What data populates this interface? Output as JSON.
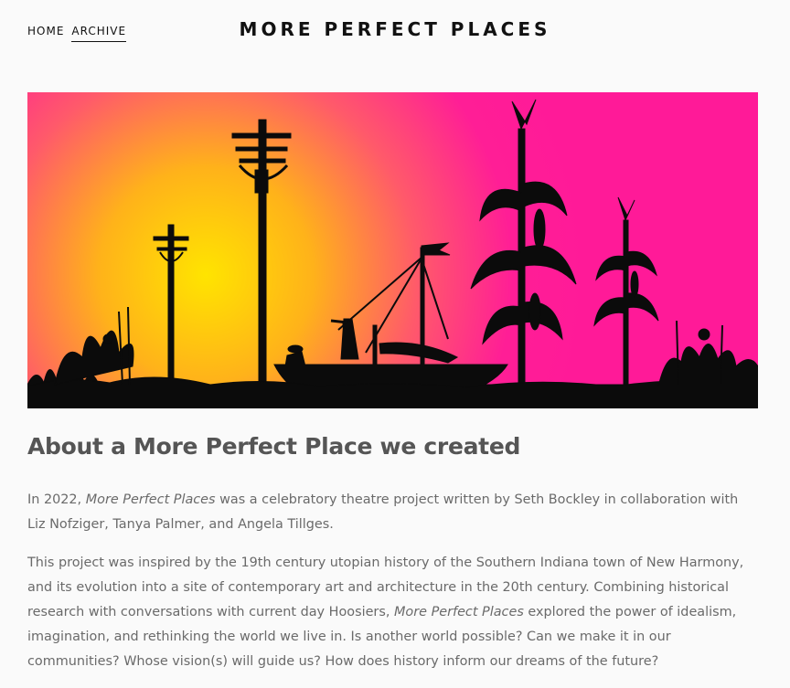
{
  "nav": {
    "home": "HOME",
    "archive": "ARCHIVE"
  },
  "site": {
    "title": "MORE PERFECT PLACES"
  },
  "hero": {
    "icon": "sunset-landscape-illustration",
    "colors": {
      "sun": "#ffe400",
      "mid": "#ff8a2a",
      "sky": "#ff1e96",
      "silhouette": "#0b0b0b"
    }
  },
  "article": {
    "heading": "About a More Perfect Place we created",
    "p1": {
      "before": "In 2022, ",
      "em": "More Perfect Places",
      "after": " was a celebratory theatre project written by Seth Bockley in collaboration with Liz Nofziger, Tanya Palmer, and Angela Tillges."
    },
    "p2": {
      "before": "This project was inspired by the 19th century utopian history of the Southern Indiana town of New Harmony, and its evolution into a site of contemporary art and architecture in the 20th century. Combining historical research with conversations with current day Hoosiers, ",
      "em": "More Perfect Places",
      "after": " explored the power of idealism, imagination, and rethinking the world we live in. Is another world possible? Can we make it in our communities? Whose vision(s) will guide us? How does history inform our dreams of the future?"
    }
  }
}
